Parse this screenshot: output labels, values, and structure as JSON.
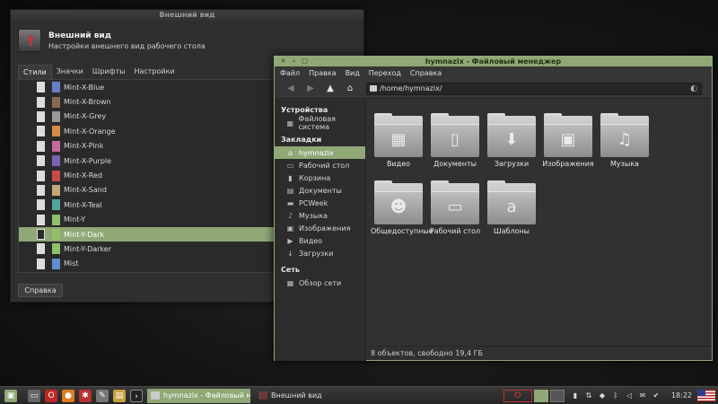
{
  "appearance": {
    "title": "Внешний вид",
    "header_title": "Внешний вид",
    "header_subtitle": "Настройки внешнего вид рабочего стола",
    "tabs": [
      {
        "label": "Стили",
        "active": true
      },
      {
        "label": "Значки",
        "active": false
      },
      {
        "label": "Шрифты",
        "active": false
      },
      {
        "label": "Настройки",
        "active": false
      }
    ],
    "themes": [
      {
        "name": "Mint-X-Blue",
        "color": "#6a7dc8"
      },
      {
        "name": "Mint-X-Brown",
        "color": "#8b6a52"
      },
      {
        "name": "Mint-X-Grey",
        "color": "#9a9a9a"
      },
      {
        "name": "Mint-X-Orange",
        "color": "#d68a45"
      },
      {
        "name": "Mint-X-Pink",
        "color": "#c56a9e"
      },
      {
        "name": "Mint-X-Purple",
        "color": "#7a64b0"
      },
      {
        "name": "Mint-X-Red",
        "color": "#c44b4b"
      },
      {
        "name": "Mint-X-Sand",
        "color": "#c2a878"
      },
      {
        "name": "Mint-X-Teal",
        "color": "#4fa69a"
      },
      {
        "name": "Mint-Y",
        "color": "#8fbf6a"
      },
      {
        "name": "Mint-Y-Dark",
        "color": "#8fbf6a",
        "selected": true
      },
      {
        "name": "Mint-Y-Darker",
        "color": "#8fbf6a"
      },
      {
        "name": "Mist",
        "color": "#5f8fcf"
      }
    ],
    "help_label": "Справка"
  },
  "filemanager": {
    "title": "hymnazix - Файловый менеджер",
    "window_buttons": [
      "✕",
      "–",
      "□"
    ],
    "menu": [
      "Файл",
      "Правка",
      "Вид",
      "Переход",
      "Справка"
    ],
    "path": "/home/hymnazix/",
    "sidebar": {
      "devices_heading": "Устройства",
      "devices": [
        {
          "label": "Файловая система",
          "icon": "▦"
        }
      ],
      "bookmarks_heading": "Закладки",
      "bookmarks": [
        {
          "label": "hymnazix",
          "icon": "⌂",
          "active": true
        },
        {
          "label": "Рабочий стол",
          "icon": "▭"
        },
        {
          "label": "Корзина",
          "icon": "▮"
        },
        {
          "label": "Документы",
          "icon": "▤"
        },
        {
          "label": "PCWeek",
          "icon": "▬"
        },
        {
          "label": "Музыка",
          "icon": "♪"
        },
        {
          "label": "Изображения",
          "icon": "▣"
        },
        {
          "label": "Видео",
          "icon": "▶"
        },
        {
          "label": "Загрузки",
          "icon": "↓"
        }
      ],
      "network_heading": "Сеть",
      "network": [
        {
          "label": "Обзор сети",
          "icon": "▦"
        }
      ]
    },
    "folders": [
      {
        "label": "Видео",
        "icon": "▦"
      },
      {
        "label": "Документы",
        "icon": "▯"
      },
      {
        "label": "Загрузки",
        "icon": "⬇"
      },
      {
        "label": "Изображения",
        "icon": "▣"
      },
      {
        "label": "Музыка",
        "icon": "♫"
      },
      {
        "label": "Общедоступные",
        "icon": "☻"
      },
      {
        "label": "Рабочий стол",
        "icon": "▭"
      },
      {
        "label": "Шаблоны",
        "icon": "a"
      }
    ],
    "status": "8 объектов, свободно 19,4 ГБ"
  },
  "taskbar": {
    "tasks": [
      {
        "label": "hymnazix - Файловый мене...",
        "active": true
      },
      {
        "label": "Внешний вид",
        "active": false
      }
    ],
    "clock": "18:22"
  },
  "colors": {
    "accent": "#8fa876"
  }
}
